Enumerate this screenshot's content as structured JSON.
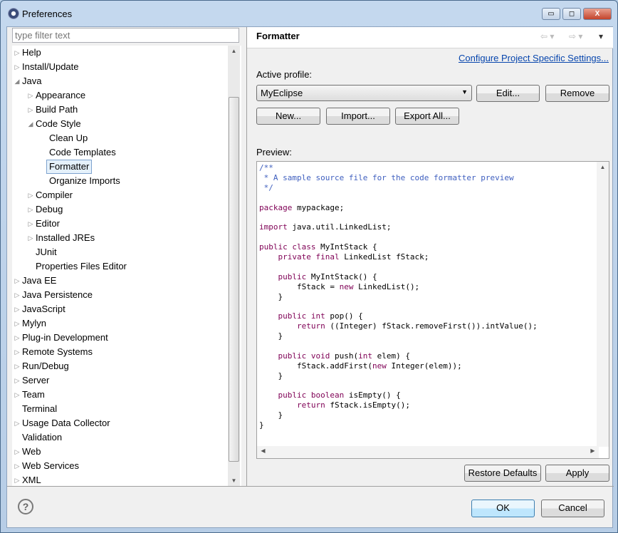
{
  "window": {
    "title": "Preferences",
    "minimize": "▭",
    "maximize": "◻",
    "close": "X"
  },
  "filter": {
    "placeholder": "type filter text"
  },
  "tree": [
    {
      "label": "Help",
      "level": 0,
      "exp": "closed"
    },
    {
      "label": "Install/Update",
      "level": 0,
      "exp": "closed"
    },
    {
      "label": "Java",
      "level": 0,
      "exp": "open"
    },
    {
      "label": "Appearance",
      "level": 1,
      "exp": "closed"
    },
    {
      "label": "Build Path",
      "level": 1,
      "exp": "closed"
    },
    {
      "label": "Code Style",
      "level": 1,
      "exp": "open"
    },
    {
      "label": "Clean Up",
      "level": 2,
      "exp": "none"
    },
    {
      "label": "Code Templates",
      "level": 2,
      "exp": "none"
    },
    {
      "label": "Formatter",
      "level": 2,
      "exp": "none",
      "selected": true
    },
    {
      "label": "Organize Imports",
      "level": 2,
      "exp": "none"
    },
    {
      "label": "Compiler",
      "level": 1,
      "exp": "closed"
    },
    {
      "label": "Debug",
      "level": 1,
      "exp": "closed"
    },
    {
      "label": "Editor",
      "level": 1,
      "exp": "closed"
    },
    {
      "label": "Installed JREs",
      "level": 1,
      "exp": "closed"
    },
    {
      "label": "JUnit",
      "level": 1,
      "exp": "none"
    },
    {
      "label": "Properties Files Editor",
      "level": 1,
      "exp": "none"
    },
    {
      "label": "Java EE",
      "level": 0,
      "exp": "closed"
    },
    {
      "label": "Java Persistence",
      "level": 0,
      "exp": "closed"
    },
    {
      "label": "JavaScript",
      "level": 0,
      "exp": "closed"
    },
    {
      "label": "Mylyn",
      "level": 0,
      "exp": "closed"
    },
    {
      "label": "Plug-in Development",
      "level": 0,
      "exp": "closed"
    },
    {
      "label": "Remote Systems",
      "level": 0,
      "exp": "closed"
    },
    {
      "label": "Run/Debug",
      "level": 0,
      "exp": "closed"
    },
    {
      "label": "Server",
      "level": 0,
      "exp": "closed"
    },
    {
      "label": "Team",
      "level": 0,
      "exp": "closed"
    },
    {
      "label": "Terminal",
      "level": 0,
      "exp": "none"
    },
    {
      "label": "Usage Data Collector",
      "level": 0,
      "exp": "closed"
    },
    {
      "label": "Validation",
      "level": 0,
      "exp": "none"
    },
    {
      "label": "Web",
      "level": 0,
      "exp": "closed"
    },
    {
      "label": "Web Services",
      "level": 0,
      "exp": "closed"
    },
    {
      "label": "XML",
      "level": 0,
      "exp": "closed"
    }
  ],
  "page": {
    "title": "Formatter",
    "config_link": "Configure Project Specific Settings...",
    "active_profile_label": "Active profile:",
    "profile": "MyEclipse",
    "edit": "Edit...",
    "remove": "Remove",
    "new": "New...",
    "import": "Import...",
    "export": "Export All...",
    "preview_label": "Preview:",
    "restore": "Restore Defaults",
    "apply": "Apply"
  },
  "code": [
    [
      [
        "cm",
        "/**"
      ]
    ],
    [
      [
        "cm",
        " * A sample source file for the code formatter preview"
      ]
    ],
    [
      [
        "cm",
        " */"
      ]
    ],
    [],
    [
      [
        "kw",
        "package"
      ],
      [
        "pl",
        " mypackage;"
      ]
    ],
    [],
    [
      [
        "kw",
        "import"
      ],
      [
        "pl",
        " java.util.LinkedList;"
      ]
    ],
    [],
    [
      [
        "kw",
        "public class"
      ],
      [
        "pl",
        " MyIntStack {"
      ]
    ],
    [
      [
        "pl",
        "    "
      ],
      [
        "kw",
        "private final"
      ],
      [
        "pl",
        " LinkedList fStack;"
      ]
    ],
    [],
    [
      [
        "pl",
        "    "
      ],
      [
        "kw",
        "public"
      ],
      [
        "pl",
        " MyIntStack() {"
      ]
    ],
    [
      [
        "pl",
        "        fStack = "
      ],
      [
        "kw",
        "new"
      ],
      [
        "pl",
        " LinkedList();"
      ]
    ],
    [
      [
        "pl",
        "    }"
      ]
    ],
    [],
    [
      [
        "pl",
        "    "
      ],
      [
        "kw",
        "public int"
      ],
      [
        "pl",
        " pop() {"
      ]
    ],
    [
      [
        "pl",
        "        "
      ],
      [
        "kw",
        "return"
      ],
      [
        "pl",
        " ((Integer) fStack.removeFirst()).intValue();"
      ]
    ],
    [
      [
        "pl",
        "    }"
      ]
    ],
    [],
    [
      [
        "pl",
        "    "
      ],
      [
        "kw",
        "public void"
      ],
      [
        "pl",
        " push("
      ],
      [
        "kw",
        "int"
      ],
      [
        "pl",
        " elem) {"
      ]
    ],
    [
      [
        "pl",
        "        fStack.addFirst("
      ],
      [
        "kw",
        "new"
      ],
      [
        "pl",
        " Integer(elem));"
      ]
    ],
    [
      [
        "pl",
        "    }"
      ]
    ],
    [],
    [
      [
        "pl",
        "    "
      ],
      [
        "kw",
        "public boolean"
      ],
      [
        "pl",
        " isEmpty() {"
      ]
    ],
    [
      [
        "pl",
        "        "
      ],
      [
        "kw",
        "return"
      ],
      [
        "pl",
        " fStack.isEmpty();"
      ]
    ],
    [
      [
        "pl",
        "    }"
      ]
    ],
    [
      [
        "pl",
        "}"
      ]
    ]
  ],
  "footer": {
    "help": "?",
    "ok": "OK",
    "cancel": "Cancel"
  }
}
